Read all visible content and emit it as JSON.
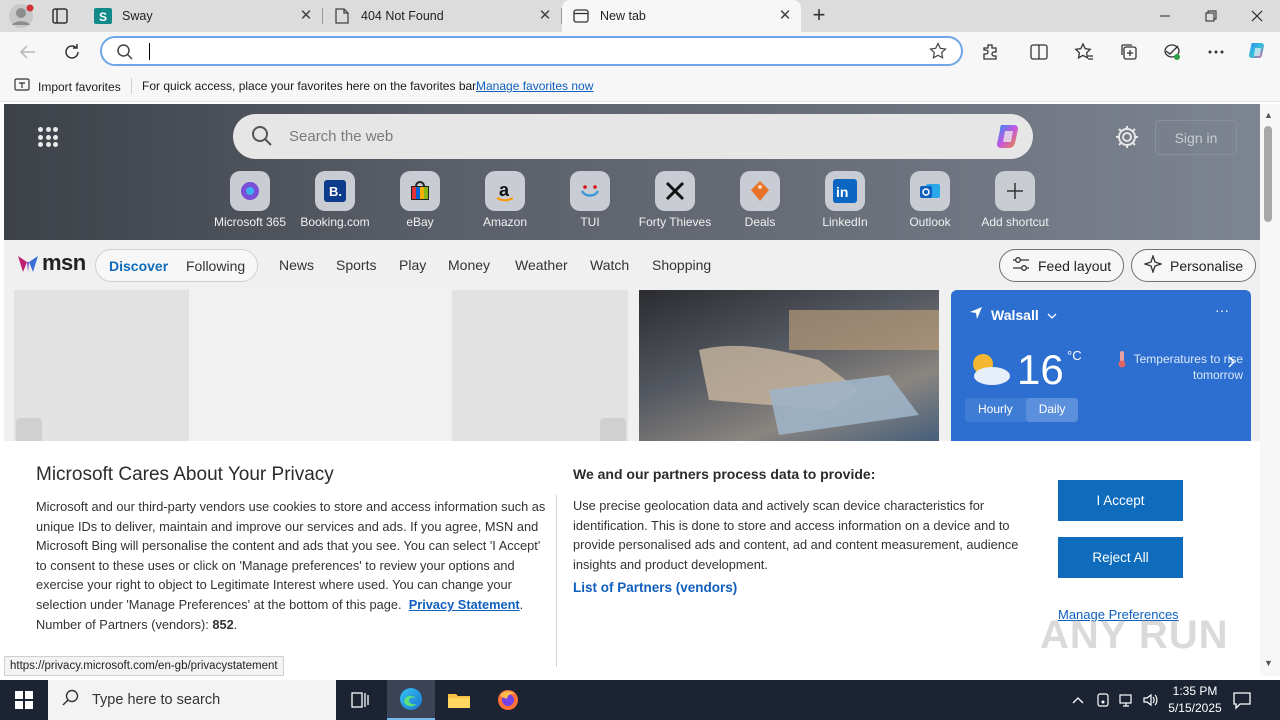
{
  "tabs": [
    {
      "title": "Sway",
      "active": false
    },
    {
      "title": "404 Not Found",
      "active": false
    },
    {
      "title": "New tab",
      "active": true
    }
  ],
  "favbar": {
    "import_label": "Import favorites",
    "message": "For quick access, place your favorites here on the favorites bar.",
    "manage_link": "Manage favorites now"
  },
  "newtab": {
    "search_placeholder": "Search the web",
    "sign_in": "Sign in",
    "shortcuts": [
      {
        "label": "Microsoft 365",
        "icon": "microsoft365-icon"
      },
      {
        "label": "Booking.com",
        "icon": "booking-icon"
      },
      {
        "label": "eBay",
        "icon": "ebay-icon"
      },
      {
        "label": "Amazon",
        "icon": "amazon-icon"
      },
      {
        "label": "TUI",
        "icon": "tui-icon"
      },
      {
        "label": "Forty Thieves",
        "icon": "forty-thieves-icon"
      },
      {
        "label": "Deals",
        "icon": "deals-icon"
      },
      {
        "label": "LinkedIn",
        "icon": "linkedin-icon"
      },
      {
        "label": "Outlook",
        "icon": "outlook-icon"
      },
      {
        "label": "Add shortcut",
        "icon": "plus-icon"
      }
    ]
  },
  "msn": {
    "logo": "msn",
    "feed_tabs": [
      "Discover",
      "Following"
    ],
    "nav": [
      "News",
      "Sports",
      "Play",
      "Money",
      "Weather",
      "Watch",
      "Shopping"
    ],
    "feed_layout": "Feed layout",
    "personalise": "Personalise"
  },
  "weather": {
    "location": "Walsall",
    "temperature": "16",
    "unit": "°C",
    "tip": "Temperatures to rise tomorrow",
    "toggle": [
      "Hourly",
      "Daily"
    ]
  },
  "privacy": {
    "title": "Microsoft Cares About Your Privacy",
    "body": "Microsoft and our third-party vendors use cookies to store and access information such as unique IDs to deliver, maintain and improve our services and ads. If you agree, MSN and Microsoft Bing will personalise the content and ads that you see. You can select 'I Accept' to consent to these uses or click on 'Manage preferences' to review your options and exercise your right to object to Legitimate Interest where used.  You can change your selection under 'Manage Preferences' at the bottom of this page.",
    "privacy_link": "Privacy Statement",
    "partners_label": "Number of Partners (vendors):",
    "partners_count": "852",
    "purposes_title": "We and our partners process data to provide:",
    "purposes_text": "Use precise geolocation data and actively scan device characteristics for identification. This is done to store and access information on a device and to provide personalised ads and content, ad and content measurement, audience insights and product development.",
    "partners_link": "List of Partners (vendors)",
    "accept": "I Accept",
    "reject": "Reject All",
    "manage": "Manage Preferences"
  },
  "status_url": "https://privacy.microsoft.com/en-gb/privacystatement",
  "watermark": "ANY RUN",
  "taskbar": {
    "search_placeholder": "Type here to search",
    "time": "1:35 PM",
    "date": "5/15/2025"
  },
  "colors": {
    "accent": "#0f6cbd",
    "weather_card": "#2c6fd0",
    "taskbar": "#1c2433"
  }
}
